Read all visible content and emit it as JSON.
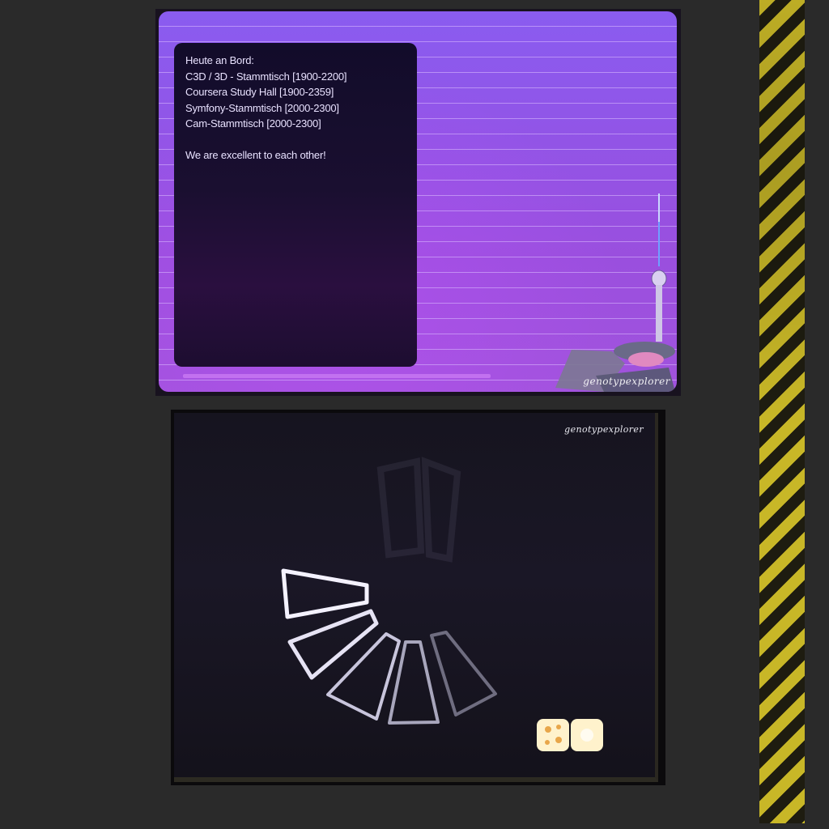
{
  "top_screen": {
    "info_lines": [
      "Heute an Bord:",
      "C3D / 3D - Stammtisch [1900-2200]",
      "Coursera Study Hall [1900-2359]",
      "Symfony-Stammtisch [2000-2300]",
      "Cam-Stammtisch [2000-2300]"
    ],
    "motto": "We are excellent to each other!",
    "logo": "genotypexplorer",
    "colors": {
      "accent": "#9a4fde",
      "panel": "#120c2a"
    }
  },
  "bottom_screen": {
    "logo": "genotypexplorer",
    "spinner": {
      "segments": 5,
      "icon": "loading-spinner-icon"
    },
    "tool_icon": "cheese-tools-icon"
  }
}
